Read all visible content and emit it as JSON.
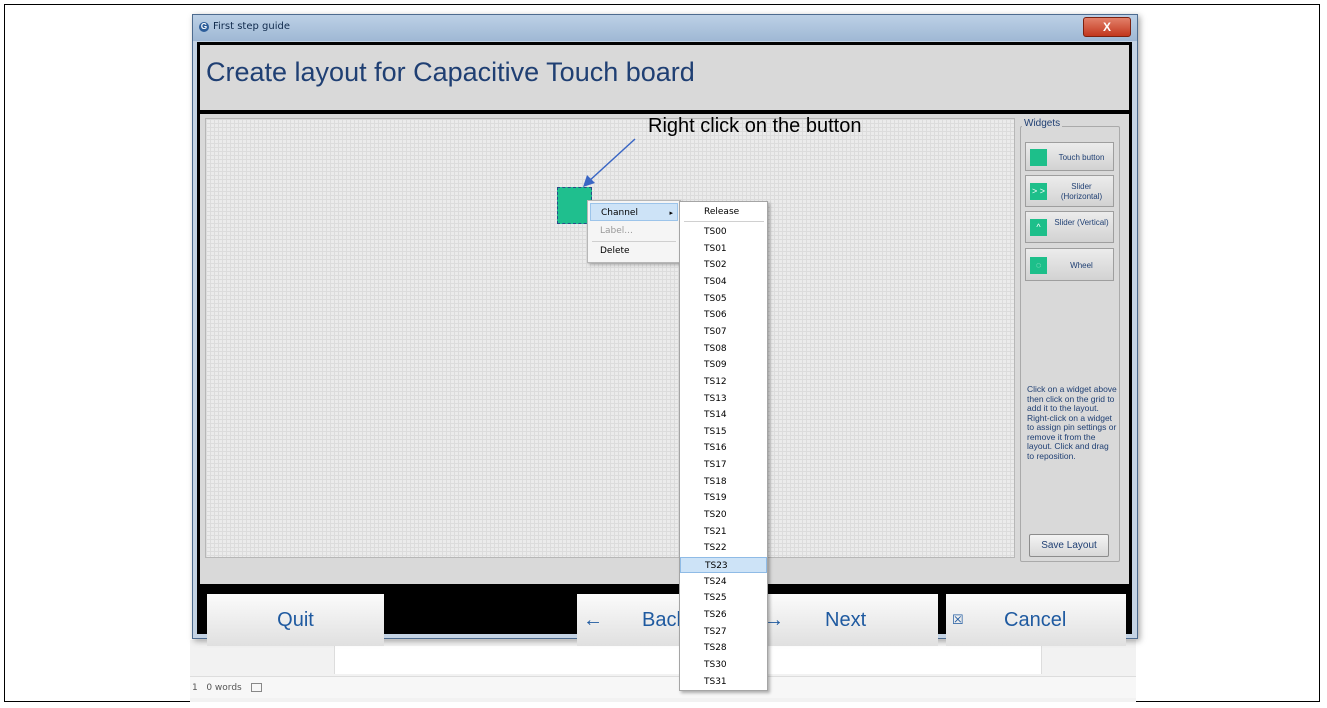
{
  "window": {
    "title": "First step guide",
    "close_glyph": "X"
  },
  "header": {
    "title": "Create layout for Capacitive Touch board"
  },
  "widgets": {
    "title": "Widgets",
    "items": [
      {
        "label": "Touch button",
        "icon": "square-icon",
        "glyph": ""
      },
      {
        "label": "Slider (Horizontal)",
        "icon": "horizontal-slider-icon",
        "glyph": "> >"
      },
      {
        "label": "Slider (Vertical)",
        "icon": "vertical-slider-icon",
        "glyph": "^"
      },
      {
        "label": "Wheel",
        "icon": "wheel-icon",
        "glyph": "◌"
      }
    ],
    "help_text": "Click on a widget above then click on the grid to add it to the layout. Right-click on a widget to assign pin settings or remove it from the layout.  Click and drag to reposition.",
    "save_label": "Save Layout"
  },
  "annotation": {
    "text": "Right click on the button"
  },
  "context_menu": {
    "items": [
      {
        "label": "Channel",
        "has_submenu": true,
        "enabled": true
      },
      {
        "label": "Label...",
        "enabled": false
      },
      {
        "label": "Delete",
        "enabled": true
      }
    ],
    "submenu_arrow": "▸"
  },
  "channel_submenu": {
    "release": "Release",
    "options": [
      "TS00",
      "TS01",
      "TS02",
      "TS04",
      "TS05",
      "TS06",
      "TS07",
      "TS08",
      "TS09",
      "TS12",
      "TS13",
      "TS14",
      "TS15",
      "TS16",
      "TS17",
      "TS18",
      "TS19",
      "TS20",
      "TS21",
      "TS22",
      "TS23",
      "TS24",
      "TS25",
      "TS26",
      "TS27",
      "TS28",
      "TS30",
      "TS31"
    ],
    "highlighted": "TS23"
  },
  "nav": {
    "quit": "Quit",
    "back": "Back",
    "back_icon": "←",
    "next": "Next",
    "next_icon": "→",
    "cancel": "Cancel",
    "cancel_icon": "☒"
  },
  "background_app": {
    "status_page": "1",
    "status_words": "0 words"
  },
  "colors": {
    "accent_green": "#1dbf8a",
    "title_blue": "#1f3f73",
    "highlight": "#cde3f7"
  }
}
